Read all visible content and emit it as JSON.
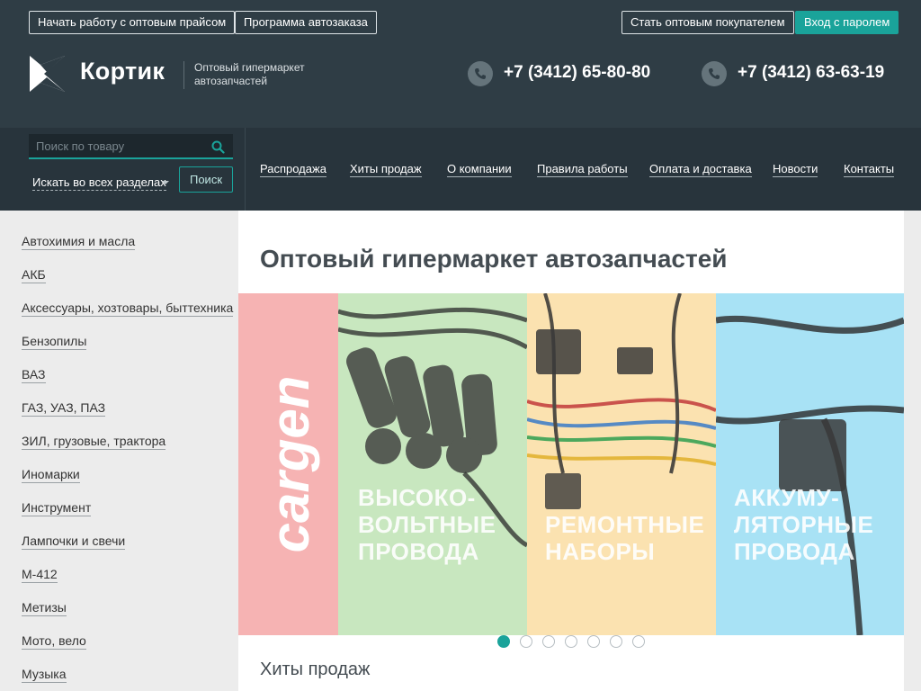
{
  "top_buttons": {
    "wholesale_price": "Начать работу с оптовым прайсом",
    "autoorder": "Программа автозаказа",
    "become_buyer": "Стать оптовым покупателем",
    "login": "Вход с паролем"
  },
  "brand": {
    "name": "Кортик",
    "tagline": "Оптовый гипермаркет автозапчастей"
  },
  "phones": [
    "+7 (3412) 65-80-80",
    "+7 (3412) 63-63-19"
  ],
  "search": {
    "placeholder": "Поиск по товару",
    "scope": "Искать во всех разделах",
    "button": "Поиск"
  },
  "nav": [
    "Распродажа",
    "Хиты продаж",
    "О компании",
    "Правила работы",
    "Оплата и доставка",
    "Новости",
    "Контакты"
  ],
  "categories": [
    "Автохимия и масла",
    "АКБ",
    "Аксессуары, хозтовары, быттехника",
    "Бензопилы",
    "ВАЗ",
    "ГАЗ, УАЗ, ПАЗ",
    "ЗИЛ, грузовые, трактора",
    "Иномарки",
    "Инструмент",
    "Лампочки и свечи",
    "М-412",
    "Метизы",
    "Мото, вело",
    "Музыка"
  ],
  "main": {
    "title": "Оптовый гипермаркет автозапчастей",
    "section_title": "Хиты продаж"
  },
  "banner": {
    "brand": "cargen",
    "panel1": [
      "ВЫСОКО-",
      "ВОЛЬТНЫЕ",
      "ПРОВОДА"
    ],
    "panel2": [
      "РЕМОНТНЫЕ",
      "НАБОРЫ"
    ],
    "panel3": [
      "АККУМУ-",
      "ЛЯТОРНЫЕ",
      "ПРОВОДА"
    ]
  },
  "slider": {
    "count": 7,
    "active": 1
  },
  "colors": {
    "header": "#2f3d45",
    "nav": "#28343c",
    "accent": "#1aa39a",
    "banner_red": "#f6b3b3",
    "banner_green": "#c8e7bf",
    "banner_yellow": "#fbe2b0",
    "banner_blue": "#a8e2f5"
  }
}
